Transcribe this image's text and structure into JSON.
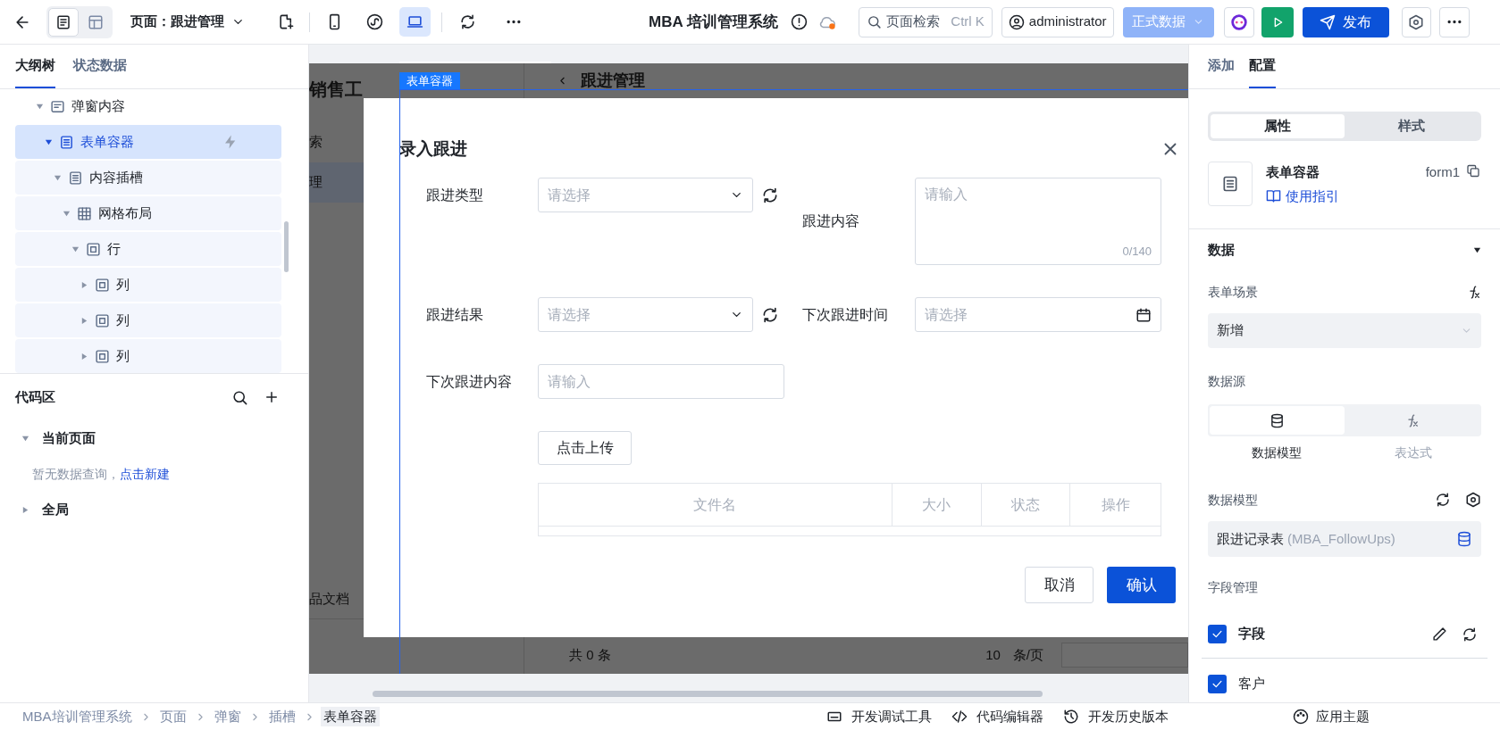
{
  "top_bar": {
    "view_toggle": [
      {
        "kind": "page",
        "selected": true
      },
      {
        "kind": "layout",
        "selected": false
      }
    ],
    "page_selector": "页面：跟进管理",
    "device_buttons": [
      {
        "kind": "mobile",
        "selected": false
      },
      {
        "kind": "miniprogram",
        "selected": false
      },
      {
        "kind": "desktop",
        "selected": true
      }
    ],
    "title": "MBA 培训管理系统",
    "search": {
      "placeholder": "页面检索",
      "shortcut": "Ctrl K"
    },
    "user": "administrator",
    "environment": "正式数据",
    "publish": "发布"
  },
  "left_panel": {
    "tabs": [
      {
        "label": "大纲树",
        "selected": true
      },
      {
        "label": "状态数据",
        "selected": false
      }
    ],
    "outline": [
      {
        "label": "弹窗内容",
        "kind": "dialog",
        "expanded": true,
        "selected": false,
        "children": [
          {
            "label": "表单容器",
            "kind": "form",
            "expanded": true,
            "selected": true,
            "children": [
              {
                "label": "内容插槽",
                "kind": "form",
                "expanded": true,
                "selected": false,
                "children": [
                  {
                    "label": "网格布局",
                    "kind": "grid",
                    "expanded": true,
                    "selected": false,
                    "children": [
                      {
                        "label": "行",
                        "kind": "box",
                        "expanded": true,
                        "selected": false,
                        "children": [
                          {
                            "label": "列",
                            "kind": "box",
                            "expanded": false,
                            "selected": false
                          },
                          {
                            "label": "列",
                            "kind": "box",
                            "expanded": false,
                            "selected": false
                          },
                          {
                            "label": "列",
                            "kind": "box",
                            "expanded": false,
                            "selected": false
                          }
                        ]
                      }
                    ]
                  }
                ]
              }
            ]
          }
        ]
      }
    ],
    "code_area": {
      "title": "代码区",
      "groups": [
        {
          "label": "当前页面",
          "expanded": true,
          "empty_text": "暂无数据查询，",
          "action": "点击新建"
        },
        {
          "label": "全局",
          "expanded": false
        }
      ]
    }
  },
  "canvas": {
    "background_page": {
      "heading": "销售工",
      "nav": [
        {
          "label": "索",
          "selected": false
        },
        {
          "label": "理",
          "selected": true
        },
        {
          "label": "品文档",
          "selected": false
        }
      ],
      "page_title": "跟进管理",
      "footer": {
        "total": "共 0 条",
        "page_size": "10",
        "per_page": "条/页"
      }
    },
    "selection_label": "表单容器",
    "modal": {
      "title": "录入跟进",
      "fields": [
        {
          "label": "跟进类型",
          "kind": "select",
          "placeholder": "请选择"
        },
        {
          "label": "跟进内容",
          "kind": "textarea",
          "placeholder": "请输入",
          "counter": "0/140"
        },
        {
          "label": "跟进结果",
          "kind": "select",
          "placeholder": "请选择"
        },
        {
          "label": "下次跟进时间",
          "kind": "date",
          "placeholder": "请选择"
        },
        {
          "label": "下次跟进内容",
          "kind": "input",
          "placeholder": "请输入"
        }
      ],
      "upload_button": "点击上传",
      "file_table": {
        "columns": [
          "文件名",
          "大小",
          "状态",
          "操作"
        ]
      },
      "buttons": [
        {
          "label": "取消",
          "kind": "secondary"
        },
        {
          "label": "确认",
          "kind": "primary"
        }
      ]
    }
  },
  "right_panel": {
    "tabs": [
      {
        "label": "添加",
        "selected": false
      },
      {
        "label": "配置",
        "selected": true
      }
    ],
    "mode_tabs": [
      {
        "label": "属性",
        "selected": true
      },
      {
        "label": "样式",
        "selected": false
      }
    ],
    "component": {
      "name": "表单容器",
      "id": "form1",
      "guide": "使用指引"
    },
    "section": {
      "title": "数据",
      "expanded": true
    },
    "form_scene": {
      "label": "表单场景",
      "value": "新增"
    },
    "data_source": {
      "label": "数据源",
      "options": [
        {
          "label": "数据模型",
          "kind": "database",
          "selected": true
        },
        {
          "label": "表达式",
          "kind": "expression",
          "selected": false
        }
      ]
    },
    "data_model": {
      "label": "数据模型",
      "value": "跟进记录表",
      "hint": "(MBA_FollowUps)"
    },
    "field_management": {
      "label": "字段管理",
      "items": [
        {
          "label": "字段",
          "checked": true,
          "kind": "header"
        },
        {
          "label": "客户",
          "checked": true,
          "kind": "field"
        }
      ]
    }
  },
  "bottom_bar": {
    "breadcrumb": [
      {
        "label": "MBA培训管理系统",
        "selected": false
      },
      {
        "label": "页面",
        "selected": false
      },
      {
        "label": "弹窗",
        "selected": false
      },
      {
        "label": "插槽",
        "selected": false
      },
      {
        "label": "表单容器",
        "selected": true
      }
    ],
    "tools": [
      {
        "label": "开发调试工具",
        "kind": "debug"
      },
      {
        "label": "代码编辑器",
        "kind": "code"
      },
      {
        "label": "开发历史版本",
        "kind": "history"
      }
    ],
    "theme": "应用主题"
  }
}
